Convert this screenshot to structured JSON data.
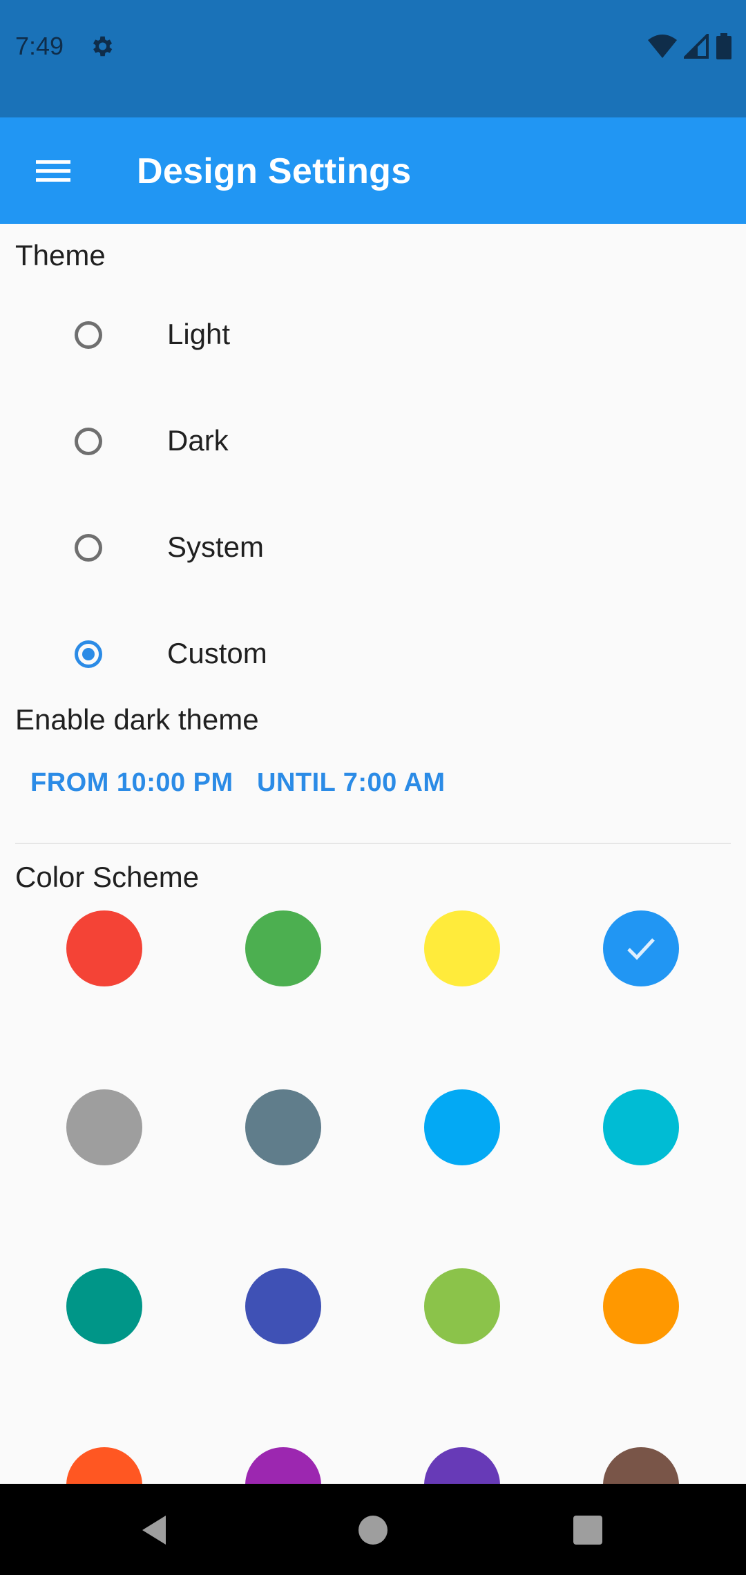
{
  "status_bar": {
    "time": "7:49",
    "icons": [
      "gear-icon",
      "wifi-icon",
      "signal-icon",
      "battery-icon"
    ]
  },
  "app_bar": {
    "title": "Design Settings",
    "menu_icon": "hamburger-menu-icon",
    "background": "#2196f3"
  },
  "theme": {
    "heading": "Theme",
    "options": [
      {
        "label": "Light",
        "selected": false
      },
      {
        "label": "Dark",
        "selected": false
      },
      {
        "label": "System",
        "selected": false
      },
      {
        "label": "Custom",
        "selected": true
      }
    ]
  },
  "dark_theme": {
    "heading": "Enable dark theme",
    "from_label": "FROM 10:00 PM",
    "until_label": "UNTIL 7:00 AM"
  },
  "color_scheme": {
    "heading": "Color Scheme",
    "selected_index": 3,
    "colors": [
      "#f44336",
      "#4caf50",
      "#ffeb3b",
      "#2196f3",
      "#9e9e9e",
      "#607d8b",
      "#03a9f4",
      "#00bcd4",
      "#009688",
      "#3f51b5",
      "#8bc34a",
      "#ff9800",
      "#ff5722",
      "#9c27b0",
      "#673ab7",
      "#795548"
    ]
  },
  "nav_bar": {
    "buttons": [
      "back-icon",
      "home-icon",
      "recents-icon"
    ]
  }
}
